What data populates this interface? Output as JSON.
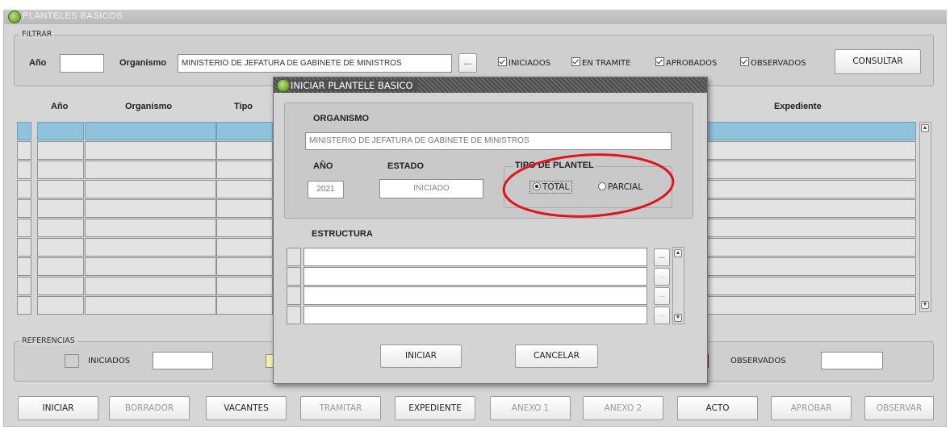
{
  "window": {
    "title": "PLANTELES BASICOS"
  },
  "filter": {
    "group_label": "FILTRAR",
    "year_label": "Año",
    "year_value": "",
    "org_label": "Organismo",
    "org_value": "MINISTERIO DE JEFATURA DE GABINETE DE MINISTROS",
    "lookup_label": "...",
    "checkboxes": [
      "INICIADOS",
      "EN TRAMITE",
      "APROBADOS",
      "OBSERVADOS"
    ],
    "consult_label": "CONSULTAR"
  },
  "table": {
    "headers": {
      "year": "Año",
      "org": "Organismo",
      "type": "Tipo",
      "expediente": "Expediente"
    },
    "row_count": 10,
    "selected_row": 0
  },
  "references": {
    "group_label": "REFERENCIAS",
    "items": [
      {
        "label": "INICIADOS",
        "color": "#cfcfcf"
      },
      {
        "label": "OBSERVADOS",
        "color": "#e02020"
      }
    ],
    "mid_color": "#f2f2a8"
  },
  "toolbar": {
    "buttons": [
      {
        "label": "INICIAR",
        "enabled": true
      },
      {
        "label": "BORRADOR",
        "enabled": false
      },
      {
        "label": "VACANTES",
        "enabled": true
      },
      {
        "label": "TRAMITAR",
        "enabled": false
      },
      {
        "label": "EXPEDIENTE",
        "enabled": true
      },
      {
        "label": "ANEXO 1",
        "enabled": false
      },
      {
        "label": "ANEXO 2",
        "enabled": false
      },
      {
        "label": "ACTO",
        "enabled": true
      },
      {
        "label": "APROBAR",
        "enabled": false
      },
      {
        "label": "OBSERVAR",
        "enabled": false
      }
    ]
  },
  "dialog": {
    "title": "INICIAR PLANTELE BASICO",
    "org_label": "ORGANISMO",
    "org_value": "MINISTERIO DE JEFATURA DE GABINETE DE MINISTROS",
    "year_label": "AÑO",
    "year_value": "2021",
    "state_label": "ESTADO",
    "state_value": "INICIADO",
    "plantel_group_label": "TIPO DE PLANTEL",
    "radio_total": "TOTAL",
    "radio_parcial": "PARCIAL",
    "selected_type": "TOTAL",
    "estructura_label": "ESTRUCTURA",
    "estructura_rows": 4,
    "lookup_label": "...",
    "start_label": "INICIAR",
    "cancel_label": "CANCELAR",
    "annotation_color": "#e0141e"
  },
  "icons": {
    "app": "app-leaf-icon",
    "scroll_up": "scroll-up-arrow-icon",
    "scroll_down": "scroll-down-arrow-icon"
  }
}
